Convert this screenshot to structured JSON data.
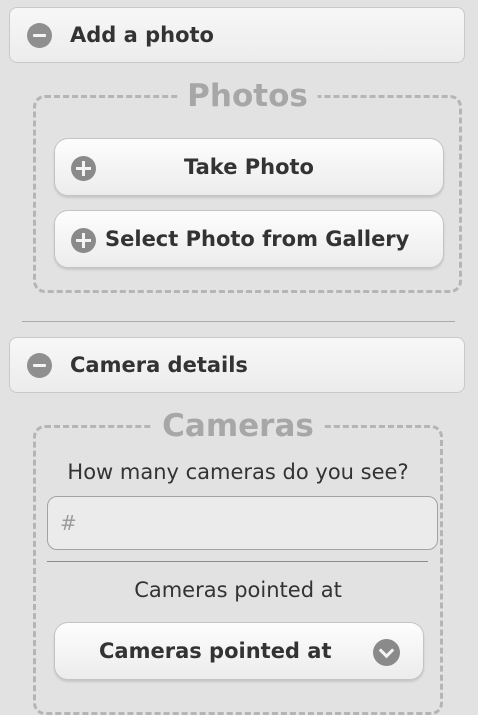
{
  "add_photo_section": {
    "header_label": "Add a photo",
    "icon": "minus-circle-icon",
    "fieldset_legend": "Photos",
    "take_photo_label": "Take Photo",
    "select_gallery_label": "Select Photo from Gallery",
    "button_icon": "plus-circle-icon"
  },
  "camera_section": {
    "header_label": "Camera details",
    "icon": "minus-circle-icon",
    "fieldset_legend": "Cameras",
    "question": "How many cameras do you see?",
    "count_placeholder": "#",
    "count_value": "",
    "pointed_label": "Cameras pointed at",
    "pointed_select_value": "Cameras pointed at",
    "select_icon": "chevron-down-circle-icon"
  }
}
